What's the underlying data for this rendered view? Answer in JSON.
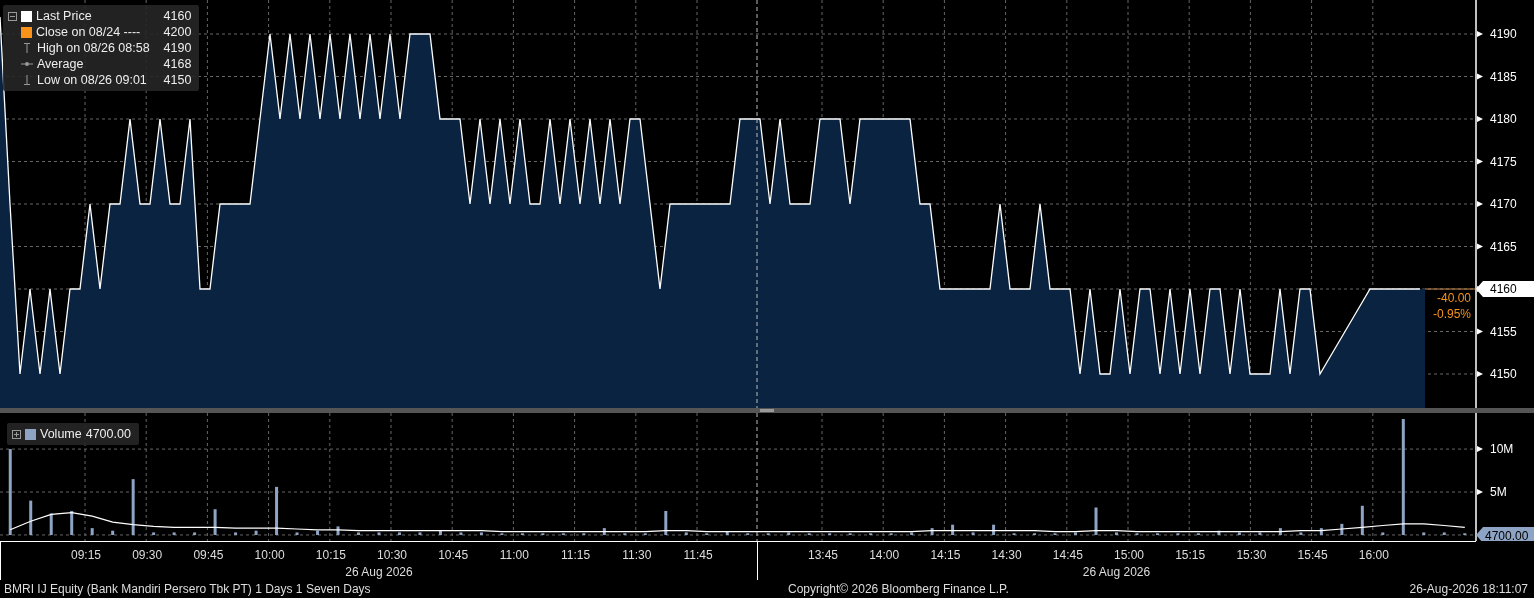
{
  "legend": [
    {
      "kind": "swatch",
      "label": "Last Price",
      "value": "4160",
      "color": "#ffffff"
    },
    {
      "kind": "swatch",
      "label": "Close on 08/24 ----",
      "value": "4200",
      "color": "#f7931a"
    },
    {
      "kind": "high",
      "label": "High on 08/26 08:58",
      "value": "4190"
    },
    {
      "kind": "average",
      "label": "Average",
      "value": "4168"
    },
    {
      "kind": "low",
      "label": "Low on 08/26 09:01",
      "value": "4150"
    }
  ],
  "price_chart": {
    "chart_data": {
      "type": "area",
      "grid": true,
      "ylim": [
        4146,
        4194
      ],
      "yticks": [
        4150,
        4155,
        4160,
        4165,
        4170,
        4175,
        4180,
        4185,
        4190
      ],
      "series": [
        {
          "color": "#ffffff",
          "values": [
            4192,
            4170,
            4150,
            4160,
            4150,
            4160,
            4150,
            4160,
            4160,
            4170,
            4160,
            4170,
            4170,
            4180,
            4170,
            4170,
            4180,
            4170,
            4170,
            4180,
            4160,
            4160,
            4170,
            4170,
            4170,
            4170,
            4180,
            4190,
            4180,
            4190,
            4180,
            4190,
            4180,
            4190,
            4180,
            4190,
            4180,
            4190,
            4180,
            4190,
            4180,
            4190,
            4190,
            4190,
            4180,
            4180,
            4180,
            4170,
            4180,
            4170,
            4180,
            4170,
            4180,
            4170,
            4170,
            4180,
            4170,
            4180,
            4170,
            4180,
            4170,
            4180,
            4170,
            4180,
            4180,
            4170,
            4160,
            4170,
            4170,
            4170,
            4170,
            4170,
            4170,
            4170,
            4180,
            4180,
            4180,
            4170,
            4180,
            4170,
            4170,
            4170,
            4180,
            4180,
            4180,
            4170,
            4180,
            4180,
            4180,
            4180,
            4180,
            4180,
            4170,
            4170,
            4160,
            4160,
            4160,
            4160,
            4160,
            4160,
            4170,
            4160,
            4160,
            4160,
            4170,
            4160,
            4160,
            4160,
            4150,
            4160,
            4150,
            4150,
            4160,
            4150,
            4160,
            4160,
            4150,
            4160,
            4150,
            4160,
            4150,
            4160,
            4160,
            4150,
            4160,
            4150,
            4150,
            4150,
            4160,
            4150,
            4160,
            4160,
            4150,
            4152,
            4154,
            4156,
            4158,
            4160,
            4160,
            4160,
            4160,
            4160,
            4160
          ]
        }
      ]
    },
    "last_price_label": "4160",
    "change": "-40.00",
    "change_pct": "-0.95%"
  },
  "volume_chart": {
    "legend": {
      "label": "Volume",
      "value": "4700.00",
      "color": "#8ea4c4"
    },
    "chart_data": {
      "type": "bar",
      "grid": true,
      "ylim": [
        0,
        14.2
      ],
      "yticks": [
        {
          "value": 5,
          "label": "5M"
        },
        {
          "value": 10,
          "label": "10M"
        }
      ],
      "series": [
        {
          "color": "#8ea4c4",
          "values": [
            10,
            4,
            2.5,
            2.8,
            0.8,
            0.5,
            6.5,
            0.3,
            0.3,
            0.3,
            3,
            0.3,
            0.5,
            5.6,
            0.3,
            0.5,
            1,
            0.3,
            0.3,
            0.3,
            0.3,
            0.5,
            0.3,
            0.3,
            0.2,
            0.2,
            0.2,
            0.2,
            0.2,
            0.8,
            0.2,
            0.2,
            2.8,
            0.3,
            0.2,
            0.4,
            0.2,
            0.2,
            0.3,
            0.2,
            0.2,
            0.2,
            0.2,
            0.2,
            0.3,
            0.8,
            1.2,
            0.3,
            1.2,
            0.2,
            0.2,
            0.2,
            0.3,
            3.2,
            0.3,
            0.2,
            0.2,
            0.2,
            0.2,
            0.5,
            0.3,
            0.3,
            0.8,
            0.3,
            0.8,
            1.3,
            3.4,
            0.3,
            13.5,
            0.3,
            0.3,
            0.2
          ]
        },
        {
          "type": "line",
          "color": "#ffffff",
          "values": [
            0.6,
            1.6,
            2.4,
            2.6,
            2.2,
            1.5,
            1.2,
            1.0,
            0.9,
            0.9,
            0.9,
            0.8,
            0.8,
            0.8,
            0.7,
            0.6,
            0.6,
            0.5,
            0.5,
            0.5,
            0.5,
            0.5,
            0.5,
            0.5,
            0.4,
            0.4,
            0.4,
            0.4,
            0.4,
            0.4,
            0.4,
            0.4,
            0.5,
            0.5,
            0.4,
            0.4,
            0.4,
            0.4,
            0.4,
            0.4,
            0.4,
            0.4,
            0.4,
            0.4,
            0.4,
            0.5,
            0.5,
            0.5,
            0.5,
            0.5,
            0.5,
            0.4,
            0.4,
            0.5,
            0.5,
            0.4,
            0.4,
            0.4,
            0.4,
            0.4,
            0.4,
            0.4,
            0.4,
            0.5,
            0.5,
            0.7,
            0.9,
            1.1,
            1.3,
            1.3,
            1.1,
            0.9
          ]
        }
      ]
    },
    "last_volume_label": "4700.00"
  },
  "x_axis": {
    "sessions": [
      {
        "labels": [
          "09:15",
          "09:30",
          "09:45",
          "10:00",
          "10:15",
          "10:30",
          "10:45",
          "11:00",
          "11:15",
          "11:30",
          "11:45"
        ],
        "date": "26 Aug 2026"
      },
      {
        "labels": [
          "13:45",
          "14:00",
          "14:15",
          "14:30",
          "14:45",
          "15:00",
          "15:15",
          "15:30",
          "15:45",
          "16:00"
        ],
        "date": "26 Aug 2026"
      }
    ]
  },
  "footer": {
    "security": "BMRI IJ Equity (Bank Mandiri Persero Tbk PT) 1 Days 1 Seven Days",
    "copyright": "Copyright© 2026 Bloomberg Finance L.P.",
    "timestamp": "26-Aug-2026 18:11:07"
  }
}
